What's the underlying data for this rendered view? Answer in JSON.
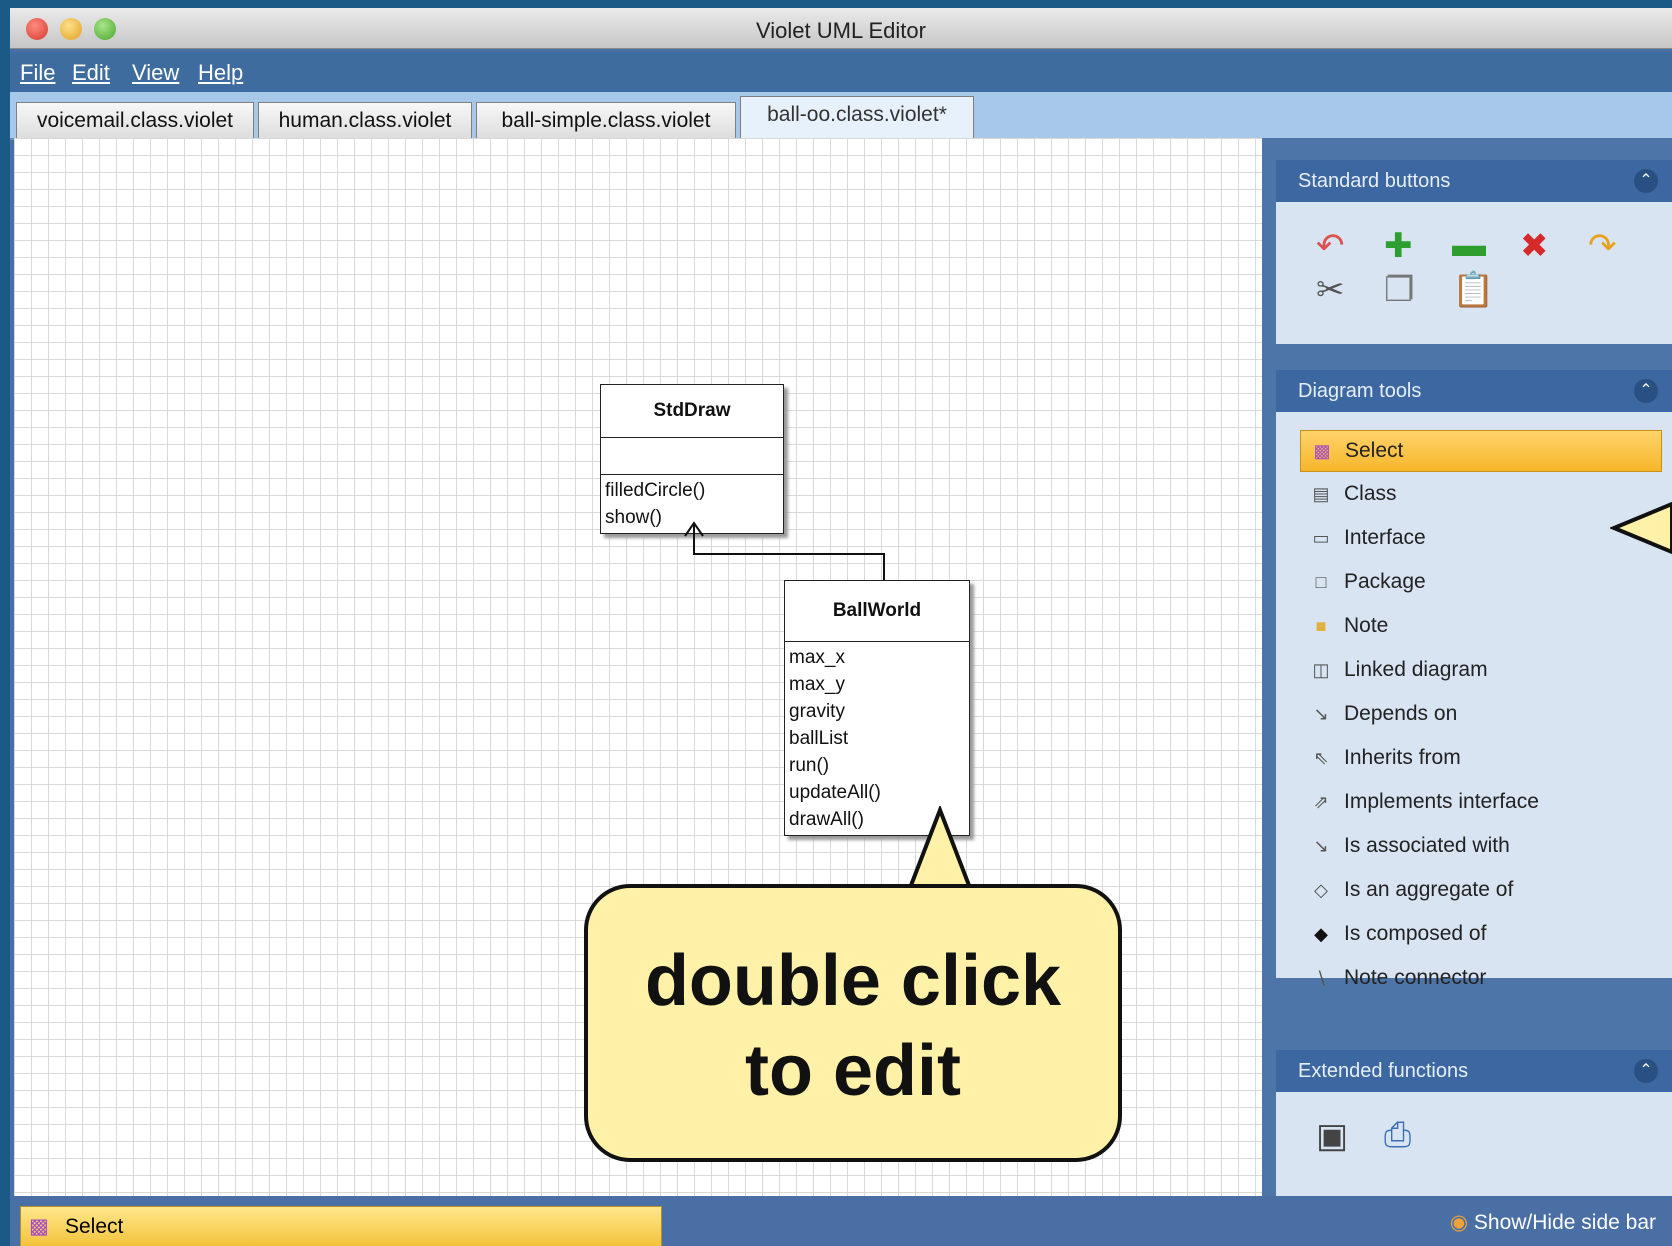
{
  "window": {
    "title": "Violet UML Editor"
  },
  "menu": [
    "File",
    "Edit",
    "View",
    "Help"
  ],
  "tabs": [
    {
      "label": "voicemail.class.violet"
    },
    {
      "label": "human.class.violet"
    },
    {
      "label": "ball-simple.class.violet"
    },
    {
      "label": "ball-oo.class.violet*",
      "active": true
    }
  ],
  "diagram": {
    "classes": [
      {
        "name": "StdDraw",
        "attributes": [],
        "methods": [
          "filledCircle()",
          "show()"
        ]
      },
      {
        "name": "BallWorld",
        "attributes": [
          "max_x",
          "max_y",
          "gravity",
          "ballList"
        ],
        "methods": [
          "run()",
          "updateAll()",
          "drawAll()"
        ]
      }
    ],
    "dependency": {
      "from": "BallWorld",
      "to": "StdDraw"
    }
  },
  "sidebar": {
    "standard_buttons": {
      "title": "Standard buttons",
      "icons": [
        "undo-icon",
        "add-icon",
        "remove-icon",
        "delete-icon",
        "redo-icon",
        "cut-icon",
        "copy-icon",
        "paste-icon"
      ]
    },
    "diagram_tools": {
      "title": "Diagram tools",
      "items": [
        {
          "label": "Select",
          "icon": "select-icon",
          "selected": true
        },
        {
          "label": "Class",
          "icon": "class-icon"
        },
        {
          "label": "Interface",
          "icon": "interface-icon"
        },
        {
          "label": "Package",
          "icon": "package-icon"
        },
        {
          "label": "Note",
          "icon": "note-icon"
        },
        {
          "label": "Linked diagram",
          "icon": "linked-diagram-icon"
        },
        {
          "label": "Depends on",
          "icon": "depends-on-icon"
        },
        {
          "label": "Inherits from",
          "icon": "inherits-icon"
        },
        {
          "label": "Implements interface",
          "icon": "implements-icon"
        },
        {
          "label": "Is associated with",
          "icon": "association-icon"
        },
        {
          "label": "Is an aggregate of",
          "icon": "aggregate-icon"
        },
        {
          "label": "Is composed of",
          "icon": "composition-icon"
        },
        {
          "label": "Note connector",
          "icon": "note-connector-icon"
        }
      ]
    },
    "extended_functions": {
      "title": "Extended functions",
      "icons": [
        "export-image-icon",
        "print-icon"
      ]
    }
  },
  "status": {
    "current_tool": "Select",
    "toggle_label": "Show/Hide side bar"
  },
  "callout": {
    "line1": "double click",
    "line2": "to edit"
  },
  "colors": {
    "selection": "#f6b62b",
    "panel_header": "#3d67a0",
    "callout_fill": "#fff2a8"
  }
}
